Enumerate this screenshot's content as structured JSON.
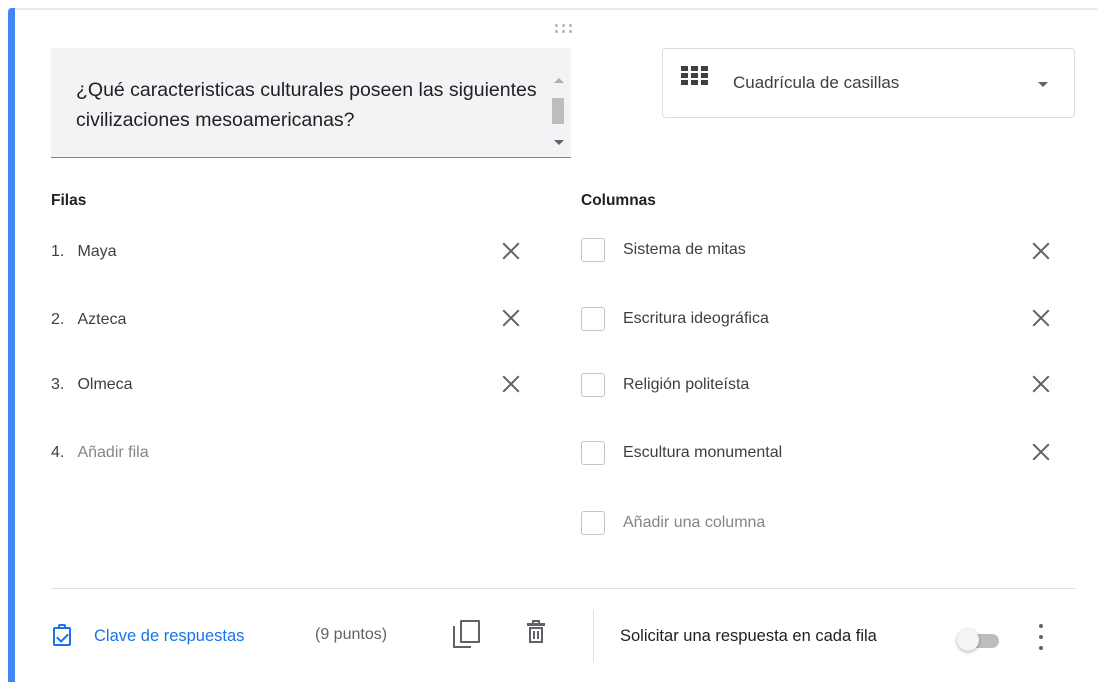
{
  "question": {
    "text": "¿Qué caracteristicas culturales poseen las siguientes civilizaciones mesoamericanas?"
  },
  "type_selector": {
    "icon": "grid-icon",
    "selected": "Cuadrícula de casillas"
  },
  "rows": {
    "title": "Filas",
    "items": [
      {
        "num": "1.",
        "label": "Maya"
      },
      {
        "num": "2.",
        "label": "Azteca"
      },
      {
        "num": "3.",
        "label": "Olmeca"
      }
    ],
    "add": {
      "num": "4.",
      "label": "Añadir fila"
    }
  },
  "columns": {
    "title": "Columnas",
    "items": [
      {
        "label": "Sistema de mitas"
      },
      {
        "label": "Escritura ideográfica"
      },
      {
        "label": "Religión politeísta"
      },
      {
        "label": "Escultura monumental"
      }
    ],
    "add": {
      "label": "Añadir una columna"
    }
  },
  "footer": {
    "answer_key_label": "Clave de respuestas",
    "points": "(9 puntos)",
    "require_label": "Solicitar una respuesta en cada fila",
    "require_toggle_on": false
  },
  "colors": {
    "accent": "#4285f4",
    "link": "#1a73e8"
  }
}
